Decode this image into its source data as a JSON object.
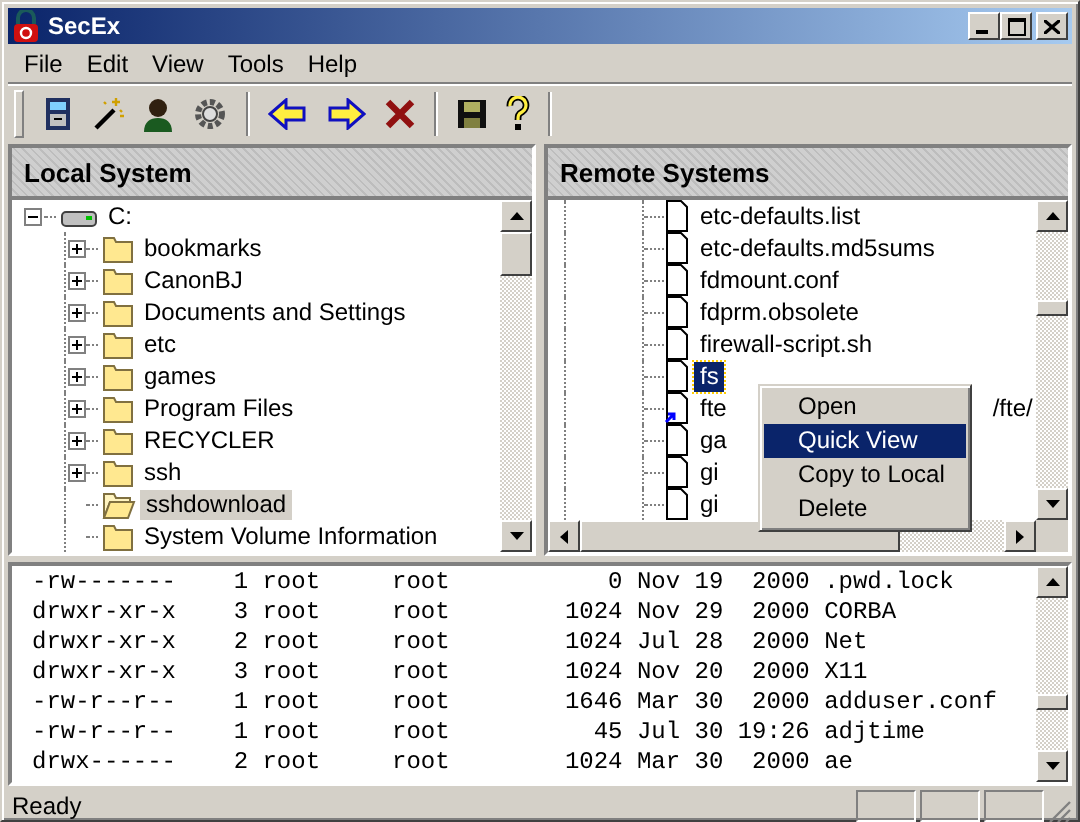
{
  "window": {
    "title": "SecEx"
  },
  "menu_bar": [
    "File",
    "Edit",
    "View",
    "Tools",
    "Help"
  ],
  "local_pane": {
    "title": "Local System",
    "tree": [
      {
        "label": "C:",
        "kind": "drive",
        "has_children": true,
        "expanded": true,
        "selected": false,
        "children": [
          {
            "label": "bookmarks",
            "kind": "folder",
            "has_children": true,
            "expanded": false,
            "selected": false
          },
          {
            "label": "CanonBJ",
            "kind": "folder",
            "has_children": true,
            "expanded": false,
            "selected": false
          },
          {
            "label": "Documents and Settings",
            "kind": "folder",
            "has_children": true,
            "expanded": false,
            "selected": false
          },
          {
            "label": "etc",
            "kind": "folder",
            "has_children": true,
            "expanded": false,
            "selected": false
          },
          {
            "label": "games",
            "kind": "folder",
            "has_children": true,
            "expanded": false,
            "selected": false
          },
          {
            "label": "Program Files",
            "kind": "folder",
            "has_children": true,
            "expanded": false,
            "selected": false
          },
          {
            "label": "RECYCLER",
            "kind": "folder",
            "has_children": true,
            "expanded": false,
            "selected": false
          },
          {
            "label": "ssh",
            "kind": "folder",
            "has_children": true,
            "expanded": false,
            "selected": false
          },
          {
            "label": "sshdownload",
            "kind": "folder",
            "has_children": false,
            "selected": true
          },
          {
            "label": "System Volume Information",
            "kind": "folder",
            "has_children": false,
            "selected": false
          }
        ]
      }
    ]
  },
  "remote_pane": {
    "title": "Remote Systems",
    "items": [
      {
        "label": "etc-defaults.list",
        "kind": "file",
        "selected": false
      },
      {
        "label": "etc-defaults.md5sums",
        "kind": "file",
        "selected": false
      },
      {
        "label": "fdmount.conf",
        "kind": "file",
        "selected": false
      },
      {
        "label": "fdprm.obsolete",
        "kind": "file",
        "selected": false
      },
      {
        "label": "firewall-script.sh",
        "kind": "file",
        "selected": false
      },
      {
        "label": "fs",
        "kind": "file",
        "selected": true
      },
      {
        "label": "fte",
        "tail": "/fte/",
        "kind": "link",
        "selected": false
      },
      {
        "label": "ga",
        "kind": "file",
        "selected": false
      },
      {
        "label": "gi",
        "kind": "file",
        "selected": false
      },
      {
        "label": "gi",
        "kind": "file",
        "selected": false
      }
    ]
  },
  "context_menu": [
    {
      "label": "Open",
      "selected": false
    },
    {
      "label": "Quick View",
      "selected": true
    },
    {
      "label": "Copy to Local",
      "selected": false
    },
    {
      "label": "Delete",
      "selected": false
    }
  ],
  "listing": [
    "-rw-------    1 root     root           0 Nov 19  2000 .pwd.lock",
    "drwxr-xr-x    3 root     root        1024 Nov 29  2000 CORBA",
    "drwxr-xr-x    2 root     root        1024 Jul 28  2000 Net",
    "drwxr-xr-x    3 root     root        1024 Nov 20  2000 X11",
    "-rw-r--r--    1 root     root        1646 Mar 30  2000 adduser.conf",
    "-rw-r--r--    1 root     root          45 Jul 30 19:26 adjtime",
    "drwx------    2 root     root        1024 Mar 30  2000 ae"
  ],
  "status_bar": {
    "text": "Ready"
  }
}
